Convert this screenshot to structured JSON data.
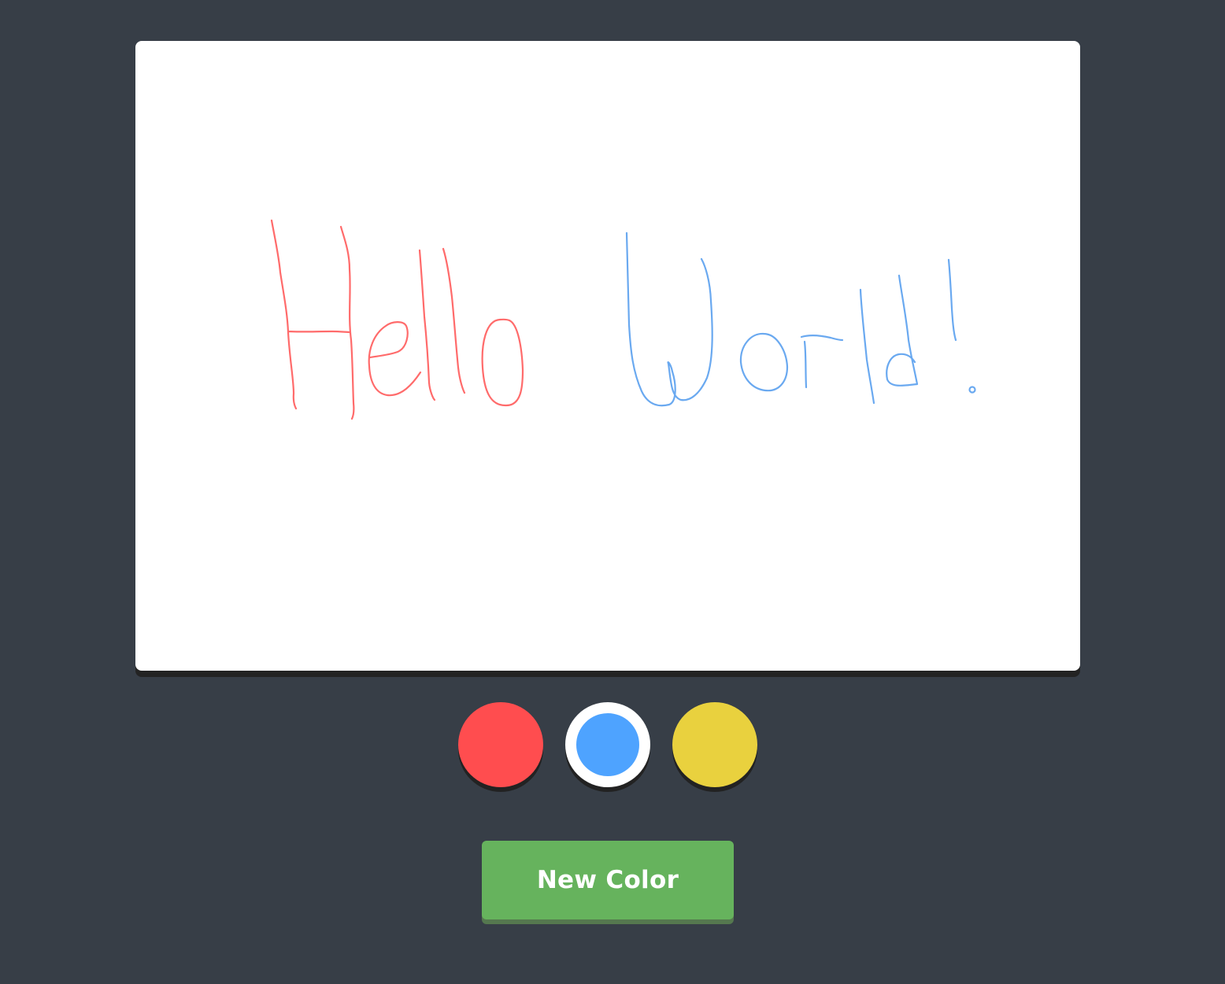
{
  "canvas": {
    "strokes": [
      {
        "color": "#ff6b6b",
        "letter": "H"
      },
      {
        "color": "#ff6b6b",
        "letter": "e"
      },
      {
        "color": "#ff6b6b",
        "letter": "l"
      },
      {
        "color": "#ff6b6b",
        "letter": "l"
      },
      {
        "color": "#ff6b6b",
        "letter": "o"
      },
      {
        "color": "#6aa9f0",
        "letter": "W"
      },
      {
        "color": "#6aa9f0",
        "letter": "o"
      },
      {
        "color": "#6aa9f0",
        "letter": "r"
      },
      {
        "color": "#6aa9f0",
        "letter": "l"
      },
      {
        "color": "#6aa9f0",
        "letter": "d"
      },
      {
        "color": "#6aa9f0",
        "letter": "!"
      }
    ]
  },
  "palette": {
    "colors": [
      {
        "name": "red",
        "hex": "#ff4d4f",
        "selected": false
      },
      {
        "name": "blue",
        "hex": "#4ea3ff",
        "selected": true
      },
      {
        "name": "yellow",
        "hex": "#e9d13e",
        "selected": false
      }
    ]
  },
  "new_color_button": {
    "label": "New Color",
    "color": "#66b35d",
    "shadow_color": "#55784f"
  }
}
